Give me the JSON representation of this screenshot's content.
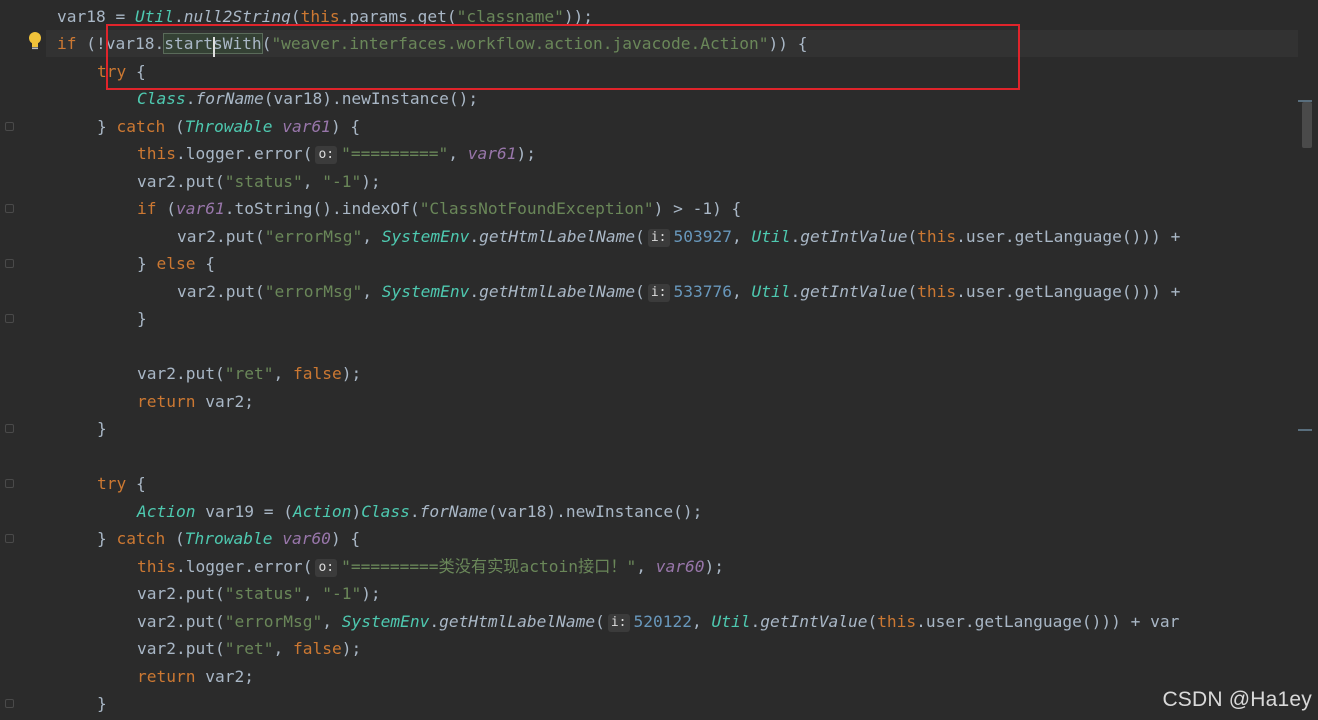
{
  "colors": {
    "background": "#2b2b2b",
    "highlight_border": "#e0242b",
    "keyword": "#cc7832",
    "string": "#6a8759",
    "method": "#ffc66d",
    "number": "#6897bb",
    "local_var": "#9876aa",
    "class_name": "#4ec9b0"
  },
  "gutter": {
    "bulb_icon": "lightbulb-icon",
    "fold_icon": "fold-marker-icon"
  },
  "code_lines": [
    {
      "indent": 3,
      "tokens": [
        {
          "t": "var18 = ",
          "c": "def"
        },
        {
          "t": "Util",
          "c": "cls"
        },
        {
          "t": ".",
          "c": "pun"
        },
        {
          "t": "null2String",
          "c": "ital"
        },
        {
          "t": "(",
          "c": "pun"
        },
        {
          "t": "this",
          "c": "kw"
        },
        {
          "t": ".params.",
          "c": "def"
        },
        {
          "t": "get",
          "c": "call"
        },
        {
          "t": "(",
          "c": "pun"
        },
        {
          "t": "\"classname\"",
          "c": "str"
        },
        {
          "t": "));",
          "c": "pun"
        }
      ]
    },
    {
      "indent": 3,
      "current": true,
      "tokens": [
        {
          "t": "if ",
          "c": "kw"
        },
        {
          "t": "(!var18.",
          "c": "def"
        },
        {
          "t": "startsWith",
          "c": "hl"
        },
        {
          "t": "(",
          "c": "pun"
        },
        {
          "t": "\"weaver.interfaces.workflow.action.javacode.Action\"",
          "c": "str"
        },
        {
          "t": ")) {",
          "c": "pun"
        }
      ]
    },
    {
      "indent": 4,
      "tokens": [
        {
          "t": "try ",
          "c": "kw"
        },
        {
          "t": "{",
          "c": "pun"
        }
      ]
    },
    {
      "indent": 5,
      "tokens": [
        {
          "t": "Class",
          "c": "cls"
        },
        {
          "t": ".",
          "c": "pun"
        },
        {
          "t": "forName",
          "c": "ital"
        },
        {
          "t": "(var18).",
          "c": "def"
        },
        {
          "t": "newInstance",
          "c": "call"
        },
        {
          "t": "();",
          "c": "pun"
        }
      ]
    },
    {
      "indent": 4,
      "tokens": [
        {
          "t": "} ",
          "c": "pun"
        },
        {
          "t": "catch ",
          "c": "kw"
        },
        {
          "t": "(",
          "c": "pun"
        },
        {
          "t": "Throwable",
          "c": "cls"
        },
        {
          "t": " ",
          "c": "def"
        },
        {
          "t": "var61",
          "c": "var"
        },
        {
          "t": ") {",
          "c": "pun"
        }
      ]
    },
    {
      "indent": 5,
      "tokens": [
        {
          "t": "this",
          "c": "kw"
        },
        {
          "t": ".logger.",
          "c": "def"
        },
        {
          "t": "error",
          "c": "call"
        },
        {
          "t": "(",
          "c": "pun"
        },
        {
          "t": "o:",
          "c": "hint"
        },
        {
          "t": "\"=========\"",
          "c": "str"
        },
        {
          "t": ", ",
          "c": "pun"
        },
        {
          "t": "var61",
          "c": "var"
        },
        {
          "t": ");",
          "c": "pun"
        }
      ]
    },
    {
      "indent": 5,
      "tokens": [
        {
          "t": "var2.",
          "c": "def"
        },
        {
          "t": "put",
          "c": "call"
        },
        {
          "t": "(",
          "c": "pun"
        },
        {
          "t": "\"status\"",
          "c": "str"
        },
        {
          "t": ", ",
          "c": "pun"
        },
        {
          "t": "\"-1\"",
          "c": "str"
        },
        {
          "t": ");",
          "c": "pun"
        }
      ]
    },
    {
      "indent": 5,
      "tokens": [
        {
          "t": "if ",
          "c": "kw"
        },
        {
          "t": "(",
          "c": "pun"
        },
        {
          "t": "var61",
          "c": "var"
        },
        {
          "t": ".",
          "c": "pun"
        },
        {
          "t": "toString",
          "c": "call"
        },
        {
          "t": "().",
          "c": "pun"
        },
        {
          "t": "indexOf",
          "c": "call"
        },
        {
          "t": "(",
          "c": "pun"
        },
        {
          "t": "\"ClassNotFoundException\"",
          "c": "str"
        },
        {
          "t": ") > -1) {",
          "c": "pun"
        }
      ]
    },
    {
      "indent": 6,
      "tokens": [
        {
          "t": "var2.",
          "c": "def"
        },
        {
          "t": "put",
          "c": "call"
        },
        {
          "t": "(",
          "c": "pun"
        },
        {
          "t": "\"errorMsg\"",
          "c": "str"
        },
        {
          "t": ", ",
          "c": "pun"
        },
        {
          "t": "SystemEnv",
          "c": "cls"
        },
        {
          "t": ".",
          "c": "pun"
        },
        {
          "t": "getHtmlLabelName",
          "c": "ital"
        },
        {
          "t": "(",
          "c": "pun"
        },
        {
          "t": "i:",
          "c": "hint"
        },
        {
          "t": "503927",
          "c": "num"
        },
        {
          "t": ", ",
          "c": "pun"
        },
        {
          "t": "Util",
          "c": "cls"
        },
        {
          "t": ".",
          "c": "pun"
        },
        {
          "t": "getIntValue",
          "c": "ital"
        },
        {
          "t": "(",
          "c": "pun"
        },
        {
          "t": "this",
          "c": "kw"
        },
        {
          "t": ".user.",
          "c": "def"
        },
        {
          "t": "getLanguage",
          "c": "call"
        },
        {
          "t": "())) +",
          "c": "pun"
        }
      ]
    },
    {
      "indent": 5,
      "tokens": [
        {
          "t": "} ",
          "c": "pun"
        },
        {
          "t": "else ",
          "c": "kw"
        },
        {
          "t": "{",
          "c": "pun"
        }
      ]
    },
    {
      "indent": 6,
      "tokens": [
        {
          "t": "var2.",
          "c": "def"
        },
        {
          "t": "put",
          "c": "call"
        },
        {
          "t": "(",
          "c": "pun"
        },
        {
          "t": "\"errorMsg\"",
          "c": "str"
        },
        {
          "t": ", ",
          "c": "pun"
        },
        {
          "t": "SystemEnv",
          "c": "cls"
        },
        {
          "t": ".",
          "c": "pun"
        },
        {
          "t": "getHtmlLabelName",
          "c": "ital"
        },
        {
          "t": "(",
          "c": "pun"
        },
        {
          "t": "i:",
          "c": "hint"
        },
        {
          "t": "533776",
          "c": "num"
        },
        {
          "t": ", ",
          "c": "pun"
        },
        {
          "t": "Util",
          "c": "cls"
        },
        {
          "t": ".",
          "c": "pun"
        },
        {
          "t": "getIntValue",
          "c": "ital"
        },
        {
          "t": "(",
          "c": "pun"
        },
        {
          "t": "this",
          "c": "kw"
        },
        {
          "t": ".user.",
          "c": "def"
        },
        {
          "t": "getLanguage",
          "c": "call"
        },
        {
          "t": "())) +",
          "c": "pun"
        }
      ]
    },
    {
      "indent": 5,
      "tokens": [
        {
          "t": "}",
          "c": "pun"
        }
      ]
    },
    {
      "indent": 0,
      "tokens": []
    },
    {
      "indent": 5,
      "tokens": [
        {
          "t": "var2.",
          "c": "def"
        },
        {
          "t": "put",
          "c": "call"
        },
        {
          "t": "(",
          "c": "pun"
        },
        {
          "t": "\"ret\"",
          "c": "str"
        },
        {
          "t": ", ",
          "c": "pun"
        },
        {
          "t": "false",
          "c": "kw"
        },
        {
          "t": ");",
          "c": "pun"
        }
      ]
    },
    {
      "indent": 5,
      "tokens": [
        {
          "t": "return ",
          "c": "kw"
        },
        {
          "t": "var2;",
          "c": "def"
        }
      ]
    },
    {
      "indent": 4,
      "tokens": [
        {
          "t": "}",
          "c": "pun"
        }
      ]
    },
    {
      "indent": 0,
      "tokens": []
    },
    {
      "indent": 4,
      "tokens": [
        {
          "t": "try ",
          "c": "kw"
        },
        {
          "t": "{",
          "c": "pun"
        }
      ]
    },
    {
      "indent": 5,
      "tokens": [
        {
          "t": "Action",
          "c": "cls"
        },
        {
          "t": " var19 = (",
          "c": "def"
        },
        {
          "t": "Action",
          "c": "cls"
        },
        {
          "t": ")",
          "c": "pun"
        },
        {
          "t": "Class",
          "c": "cls"
        },
        {
          "t": ".",
          "c": "pun"
        },
        {
          "t": "forName",
          "c": "ital"
        },
        {
          "t": "(var18).",
          "c": "def"
        },
        {
          "t": "newInstance",
          "c": "call"
        },
        {
          "t": "();",
          "c": "pun"
        }
      ]
    },
    {
      "indent": 4,
      "tokens": [
        {
          "t": "} ",
          "c": "pun"
        },
        {
          "t": "catch ",
          "c": "kw"
        },
        {
          "t": "(",
          "c": "pun"
        },
        {
          "t": "Throwable",
          "c": "cls"
        },
        {
          "t": " ",
          "c": "def"
        },
        {
          "t": "var60",
          "c": "var"
        },
        {
          "t": ") {",
          "c": "pun"
        }
      ]
    },
    {
      "indent": 5,
      "tokens": [
        {
          "t": "this",
          "c": "kw"
        },
        {
          "t": ".logger.",
          "c": "def"
        },
        {
          "t": "error",
          "c": "call"
        },
        {
          "t": "(",
          "c": "pun"
        },
        {
          "t": "o:",
          "c": "hint"
        },
        {
          "t": "\"=========类没有实现actoin接口！\"",
          "c": "str"
        },
        {
          "t": ", ",
          "c": "pun"
        },
        {
          "t": "var60",
          "c": "var"
        },
        {
          "t": ");",
          "c": "pun"
        }
      ]
    },
    {
      "indent": 5,
      "tokens": [
        {
          "t": "var2.",
          "c": "def"
        },
        {
          "t": "put",
          "c": "call"
        },
        {
          "t": "(",
          "c": "pun"
        },
        {
          "t": "\"status\"",
          "c": "str"
        },
        {
          "t": ", ",
          "c": "pun"
        },
        {
          "t": "\"-1\"",
          "c": "str"
        },
        {
          "t": ");",
          "c": "pun"
        }
      ]
    },
    {
      "indent": 5,
      "tokens": [
        {
          "t": "var2.",
          "c": "def"
        },
        {
          "t": "put",
          "c": "call"
        },
        {
          "t": "(",
          "c": "pun"
        },
        {
          "t": "\"errorMsg\"",
          "c": "str"
        },
        {
          "t": ", ",
          "c": "pun"
        },
        {
          "t": "SystemEnv",
          "c": "cls"
        },
        {
          "t": ".",
          "c": "pun"
        },
        {
          "t": "getHtmlLabelName",
          "c": "ital"
        },
        {
          "t": "(",
          "c": "pun"
        },
        {
          "t": "i:",
          "c": "hint"
        },
        {
          "t": "520122",
          "c": "num"
        },
        {
          "t": ", ",
          "c": "pun"
        },
        {
          "t": "Util",
          "c": "cls"
        },
        {
          "t": ".",
          "c": "pun"
        },
        {
          "t": "getIntValue",
          "c": "ital"
        },
        {
          "t": "(",
          "c": "pun"
        },
        {
          "t": "this",
          "c": "kw"
        },
        {
          "t": ".user.",
          "c": "def"
        },
        {
          "t": "getLanguage",
          "c": "call"
        },
        {
          "t": "())) + ",
          "c": "pun"
        },
        {
          "t": "var",
          "c": "def"
        }
      ]
    },
    {
      "indent": 5,
      "tokens": [
        {
          "t": "var2.",
          "c": "def"
        },
        {
          "t": "put",
          "c": "call"
        },
        {
          "t": "(",
          "c": "pun"
        },
        {
          "t": "\"ret\"",
          "c": "str"
        },
        {
          "t": ", ",
          "c": "pun"
        },
        {
          "t": "false",
          "c": "kw"
        },
        {
          "t": ");",
          "c": "pun"
        }
      ]
    },
    {
      "indent": 5,
      "tokens": [
        {
          "t": "return ",
          "c": "kw"
        },
        {
          "t": "var2;",
          "c": "def"
        }
      ]
    },
    {
      "indent": 4,
      "tokens": [
        {
          "t": "}",
          "c": "pun"
        }
      ]
    }
  ],
  "watermark": "CSDN @Ha1ey"
}
